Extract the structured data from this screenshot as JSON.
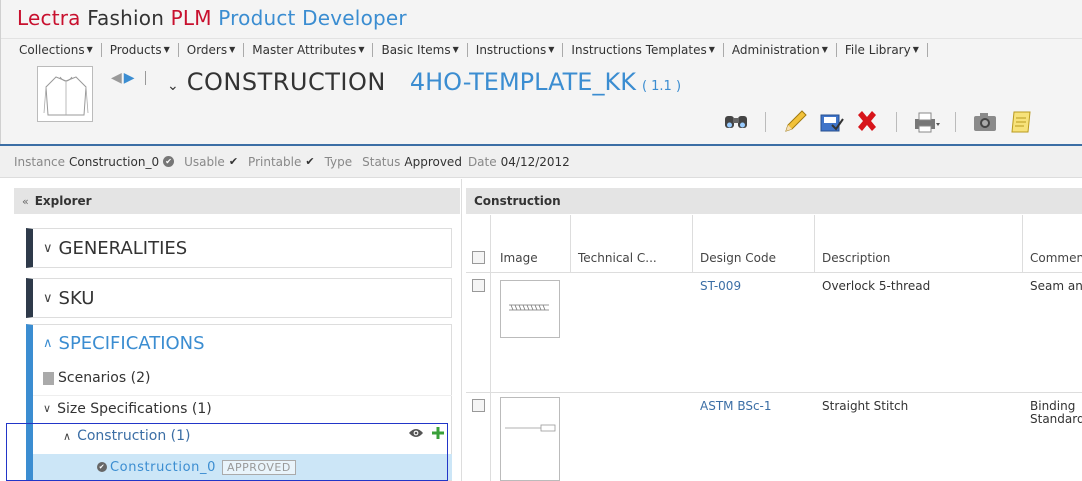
{
  "brand": {
    "part1": "Lectra",
    "part2": "Fashion",
    "part3": "PLM",
    "part4": "Product Developer"
  },
  "menu": [
    {
      "label": "Collections"
    },
    {
      "label": "Products"
    },
    {
      "label": "Orders"
    },
    {
      "label": "Master Attributes"
    },
    {
      "label": "Basic Items"
    },
    {
      "label": "Instructions"
    },
    {
      "label": "Instructions Templates"
    },
    {
      "label": "Administration"
    },
    {
      "label": "File Library"
    }
  ],
  "title": {
    "type": "CONSTRUCTION",
    "name": "4HO-TEMPLATE_KK",
    "version": "( 1.1 )"
  },
  "toolbar_icons": [
    "binoculars-icon",
    "pencil-icon",
    "save-as-icon",
    "delete-icon",
    "print-icon",
    "camera-icon",
    "notes-icon"
  ],
  "instance_bar": {
    "instance_label": "Instance",
    "instance_value": "Construction_0",
    "usable_label": "Usable",
    "printable_label": "Printable",
    "type_label": "Type",
    "status_label": "Status",
    "status_value": "Approved",
    "date_label": "Date",
    "date_value": "04/12/2012"
  },
  "explorer": {
    "title": "Explorer",
    "sections": {
      "generalities": "GENERALITIES",
      "sku": "SKU",
      "specifications": "SPECIFICATIONS"
    },
    "tree": {
      "scenarios": "Scenarios (2)",
      "size_specs": "Size Specifications (1)",
      "construction": "Construction (1)",
      "instance": "Construction_0",
      "instance_badge": "APPROVED"
    }
  },
  "grid": {
    "title": "Construction",
    "columns": [
      "Image",
      "Technical C...",
      "Design Code",
      "Description",
      "Commen"
    ],
    "rows": [
      {
        "design_code": "ST-009",
        "description": "Overlock 5-thread",
        "comment": "Seam an"
      },
      {
        "design_code": "ASTM BSc-1",
        "description": "Straight Stitch",
        "comment_line1": "Binding",
        "comment_line2": "Standard"
      }
    ]
  },
  "colors": {
    "accent": "#3b8dd1",
    "brand_red": "#c8102e",
    "nav_dark": "#2e3a4a",
    "selection_bg": "#cce6f7"
  }
}
